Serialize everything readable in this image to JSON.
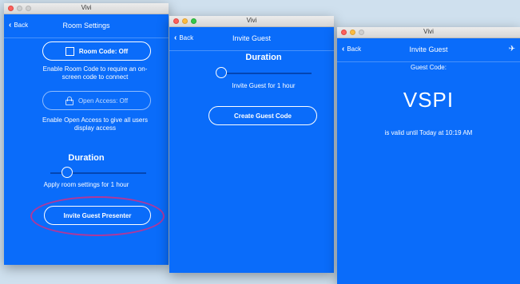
{
  "window1": {
    "titlebar": "Vivi",
    "back_label": "Back",
    "nav_title": "Room Settings",
    "room_code_button": "Room Code: Off",
    "room_code_note": "Enable Room Code to require an on-screen code to connect",
    "open_access_button": "Open Access: Off",
    "open_access_note": "Enable Open Access to give all users display access",
    "duration_heading": "Duration",
    "duration_level": 0.17,
    "duration_note": "Apply room settings for 1 hour",
    "invite_button": "Invite Guest Presenter"
  },
  "window2": {
    "titlebar": "Vivi",
    "back_label": "Back",
    "nav_title": "Invite Guest",
    "duration_heading": "Duration",
    "duration_level": 0.0,
    "duration_note": "Invite Guest for 1 hour",
    "create_button": "Create Guest Code"
  },
  "window3": {
    "titlebar": "Vivi",
    "back_label": "Back",
    "nav_title": "Invite Guest",
    "guest_code_label": "Guest Code:",
    "guest_code": "VSPI",
    "valid_note": "is valid until Today at 10:19 AM"
  },
  "colors": {
    "app_blue": "#0a6cfa",
    "highlight": "#b0389a",
    "desktop": "#cfe0ee"
  }
}
